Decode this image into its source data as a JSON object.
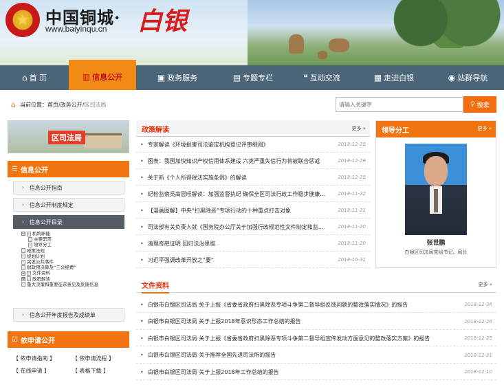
{
  "header": {
    "title": "中国铜城·",
    "brand": "白银",
    "url": "www.baiyinqu.cn"
  },
  "nav": [
    {
      "label": "首 页",
      "icon": "home-icon",
      "glyph": "⌂"
    },
    {
      "label": "信息公开",
      "icon": "chart-icon",
      "glyph": "▥",
      "active": true
    },
    {
      "label": "政务服务",
      "icon": "briefcase-icon",
      "glyph": "▣"
    },
    {
      "label": "专题专栏",
      "icon": "folder-icon",
      "glyph": "▤"
    },
    {
      "label": "互动交流",
      "icon": "chat-icon",
      "glyph": "❝"
    },
    {
      "label": "走进白银",
      "icon": "building-icon",
      "glyph": "▦"
    },
    {
      "label": "站群导航",
      "icon": "compass-icon",
      "glyph": "◉"
    }
  ],
  "breadcrumb": {
    "prefix": "当前位置：",
    "home": "首页",
    "sep": " / ",
    "mid": "政务公开",
    "current": "区司法局"
  },
  "search": {
    "placeholder": "请输入关键字",
    "button": "搜索"
  },
  "left": {
    "dept_label": "区司法局",
    "info_header": "信息公开",
    "links": [
      "信息公开指南",
      "信息公开制度规定",
      "信息公开目录"
    ],
    "tree": [
      {
        "label": "机构职能",
        "level": 0,
        "box": "⊟"
      },
      {
        "label": "主要职责",
        "level": 1
      },
      {
        "label": "领导分工",
        "level": 1
      },
      {
        "label": "政策法规",
        "level": 0
      },
      {
        "label": "规划计划",
        "level": 0
      },
      {
        "label": "突发公共事件",
        "level": 0
      },
      {
        "label": "财政预决算及“三公经费”",
        "level": 0
      },
      {
        "label": "文件资料",
        "level": 0,
        "box": "⊞"
      },
      {
        "label": "政策解读",
        "level": 0,
        "box": "⊞"
      },
      {
        "label": "重大决策和重要征求意见及反馈信息",
        "level": 0
      }
    ],
    "annual_report": "信息公开年度报告及成绩单",
    "apply_header": "依申请公开",
    "apply_links": [
      "【 依申请指南 】",
      "【 依申请流程 】",
      "【 在线申请 】",
      "【 表格下载 】"
    ]
  },
  "policy": {
    "title": "政策解读",
    "more": "更多 »",
    "items": [
      {
        "text": "专家解读《环境损害司法鉴定机构登记评审细则》",
        "date": "2018-12-29"
      },
      {
        "text": "图表：我国加快知识产权信用体系建设 六类严重失信行为将被联合惩戒",
        "date": "2018-12-29"
      },
      {
        "text": "关于新《个人所得税法实施条例》的解读",
        "date": "2018-12-29"
      },
      {
        "text": "纪检监察员高层旺解读：加强监督执纪 确保全区司法行政工作稳步健康…",
        "date": "2018-11-22"
      },
      {
        "text": "【漫画图解】中央“扫黑除恶”专项行动的十种重点打击对象",
        "date": "2018-11-21"
      },
      {
        "text": "司法部有关负责人就《国务院办公厅关于加强行政规范性文件制定和监…",
        "date": "2018-11-20"
      },
      {
        "text": "清理奇葩证明 回归法治思维",
        "date": "2018-11-20"
      },
      {
        "text": "习近平强调改革开放之“要”",
        "date": "2018-10-31"
      }
    ]
  },
  "leader": {
    "title": "领导分工",
    "more": "更多 »",
    "name": "张世鹏",
    "position": "白银区司法局党组书记、局长"
  },
  "docs": {
    "title": "文件资料",
    "more": "更多 »",
    "items": [
      {
        "text": "白银市白银区司法局 关于上报《省委省政府扫黑除恶专项斗争第二督导组反馈问题的整改落实情况》的报告",
        "date": "2018-12-26"
      },
      {
        "text": "白银市白银区司法局 关于上报2018年意识形态工作总结的报告",
        "date": "2018-12-26"
      },
      {
        "text": "白银市白银区司法局 关于上报《省委省政府扫黑除恶专项斗争第二督导组宣传发动方面意见的整改落实方案》的报告",
        "date": "2018-12-25"
      },
      {
        "text": "白银市白银区司法局 关于推荐全国先进司法所的报告",
        "date": "2018-12-21"
      },
      {
        "text": "白银市白银区司法局 关于上报2018年工作总结的报告",
        "date": "2018-12-10"
      }
    ]
  }
}
